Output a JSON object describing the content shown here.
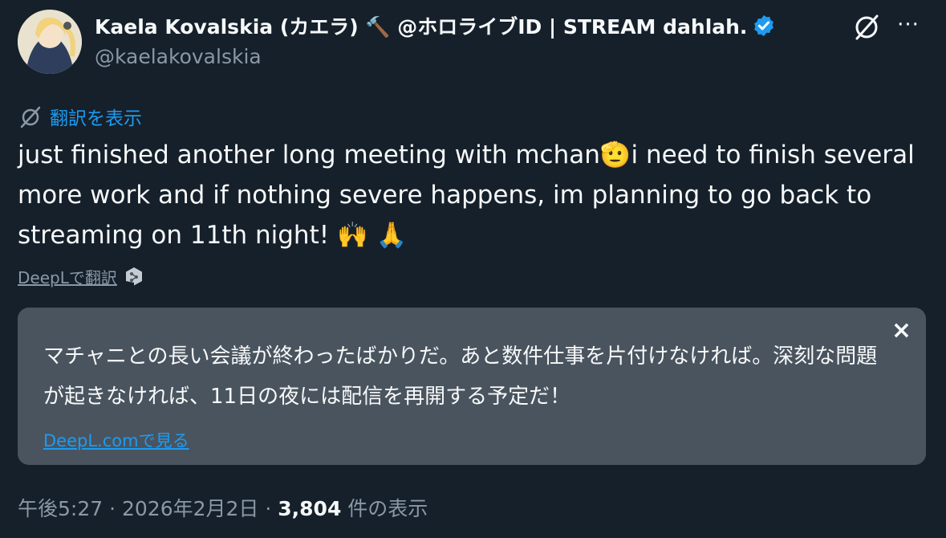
{
  "author": {
    "display_name": "Kaela Kovalskia (カエラ) 🔨 @ホロライブID | STREAM dahlah.",
    "handle": "@kaelakovalskia"
  },
  "show_translation_label": "翻訳を表示",
  "tweet_text": "just finished another long meeting with mchan🫡i need to finish several more work and if nothing severe happens, im planning to go back to streaming on 11th night! 🙌 🙏",
  "deepl_label": "DeepLで翻訳",
  "translation": {
    "text": "マチャニとの長い会議が終わったばかりだ。あと数件仕事を片付けなければ。深刻な問題が起きなければ、11日の夜には配信を再開する予定だ！",
    "close_label": "×",
    "link_label": "DeepL.comで見る"
  },
  "meta": {
    "time": "午後5:27",
    "separator1": " · ",
    "date": "2026年2月2日",
    "separator2": " · ",
    "views_count": "3,804",
    "views_label": " 件の表示"
  },
  "more_label": "···",
  "colors": {
    "background": "#15202b",
    "link": "#1d9bf0",
    "secondary_text": "#8b98a5",
    "translation_bg": "#4a545f",
    "verified": "#1d9bf0"
  },
  "icons": [
    "avatar",
    "verified-badge-icon",
    "grok-slash-icon",
    "more-icon",
    "translate-slash-icon",
    "deepl-logo-icon",
    "close-icon"
  ]
}
